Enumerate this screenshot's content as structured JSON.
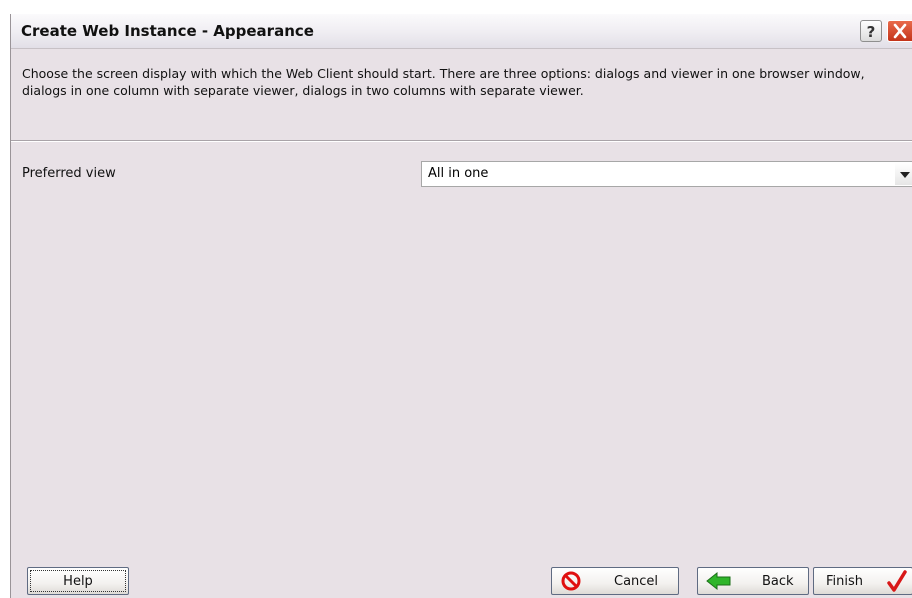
{
  "window": {
    "title": "Create Web Instance - Appearance",
    "help_glyph": "?"
  },
  "description": "Choose the screen display with which the Web Client should start. There are three options: dialogs and viewer in one browser window, dialogs in one column with separate viewer, dialogs in two columns with separate viewer.",
  "form": {
    "preferred_view_label": "Preferred view",
    "preferred_view_value": "All in one"
  },
  "buttons": {
    "help": "Help",
    "cancel": "Cancel",
    "back": "Back",
    "finish": "Finish"
  },
  "icons": {
    "cancel": "no-entry-icon",
    "back": "green-left-arrow-icon",
    "finish": "red-checkmark-icon"
  },
  "colors": {
    "dialog_bg": "#e8e1e6",
    "cancel_icon": "#e01010",
    "back_icon": "#2fb52a",
    "finish_icon": "#d81818"
  }
}
